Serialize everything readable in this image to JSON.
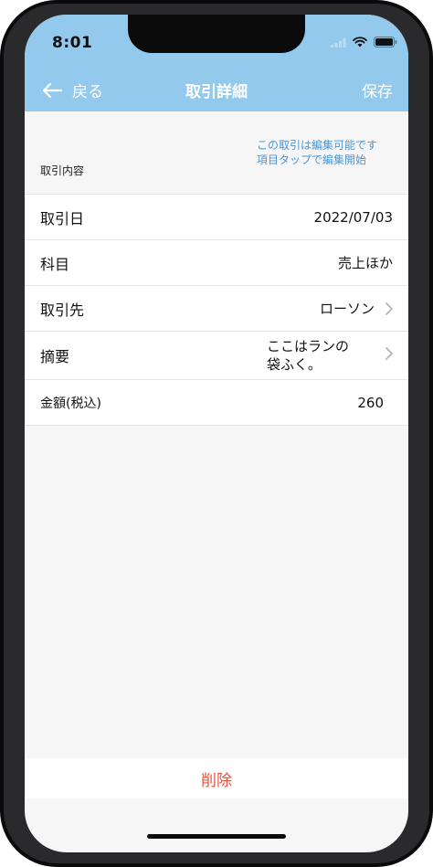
{
  "status_bar": {
    "time": "8:01",
    "icons": [
      "signal-icon",
      "wifi-icon",
      "battery-icon"
    ]
  },
  "nav": {
    "back_label": "戻る",
    "title": "取引詳細",
    "save_label": "保存"
  },
  "section": {
    "label": "取引内容",
    "hint_line1": "この取引は編集可能です",
    "hint_line2": "項目タップで編集開始"
  },
  "fields": {
    "date": {
      "label": "取引日",
      "value": "2022/07/03"
    },
    "account": {
      "label": "科目",
      "value": "売上ほか"
    },
    "partner": {
      "label": "取引先",
      "value": "ローソン"
    },
    "memo": {
      "label": "摘要",
      "value_line1": "ここはランの",
      "value_line2": "袋ふく。"
    },
    "amount": {
      "label": "金額(税込)",
      "value": "260"
    }
  },
  "footer": {
    "delete_label": "削除"
  },
  "colors": {
    "header": "#92c9ec",
    "hint": "#4a96d6",
    "delete": "#e0533f",
    "background": "#f6f6f6"
  }
}
